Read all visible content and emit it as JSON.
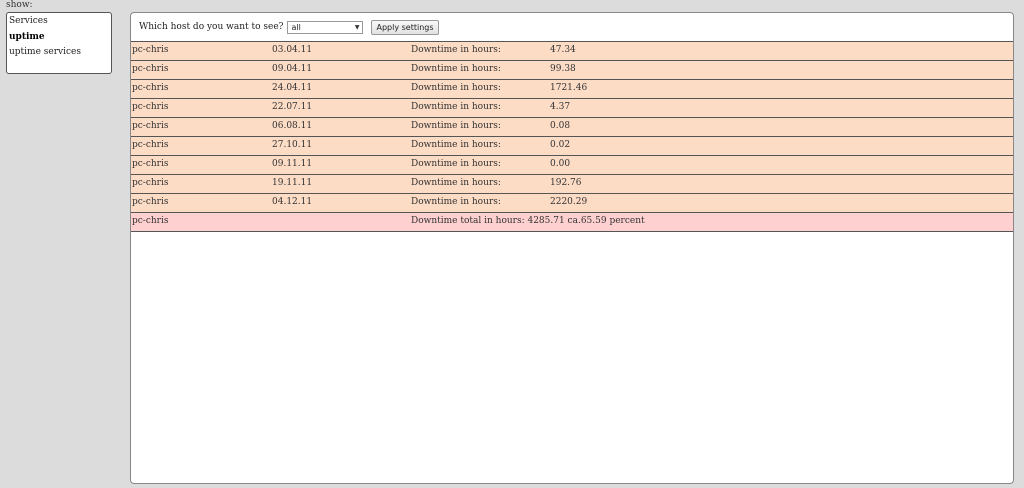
{
  "show_label": "show:",
  "nav": {
    "items": [
      {
        "label": "Services",
        "active": false
      },
      {
        "label": "uptime",
        "active": true
      },
      {
        "label": "uptime services",
        "active": false
      }
    ]
  },
  "toolbar": {
    "question": "Which host do you want to see?",
    "selected_host": "all",
    "apply_label": "Apply settings"
  },
  "rows": [
    {
      "host": "pc-chris",
      "date": "03.04.11",
      "label": "Downtime in hours:",
      "value": "47.34"
    },
    {
      "host": "pc-chris",
      "date": "09.04.11",
      "label": "Downtime in hours:",
      "value": "99.38"
    },
    {
      "host": "pc-chris",
      "date": "24.04.11",
      "label": "Downtime in hours:",
      "value": "1721.46"
    },
    {
      "host": "pc-chris",
      "date": "22.07.11",
      "label": "Downtime in hours:",
      "value": "4.37"
    },
    {
      "host": "pc-chris",
      "date": "06.08.11",
      "label": "Downtime in hours:",
      "value": "0.08"
    },
    {
      "host": "pc-chris",
      "date": "27.10.11",
      "label": "Downtime in hours:",
      "value": "0.02"
    },
    {
      "host": "pc-chris",
      "date": "09.11.11",
      "label": "Downtime in hours:",
      "value": "0.00"
    },
    {
      "host": "pc-chris",
      "date": "19.11.11",
      "label": "Downtime in hours:",
      "value": "192.76"
    },
    {
      "host": "pc-chris",
      "date": "04.12.11",
      "label": "Downtime in hours:",
      "value": "2220.29"
    }
  ],
  "total": {
    "host": "pc-chris",
    "text": "Downtime total in hours: 4285.71 ca.65.59 percent"
  },
  "colors": {
    "row_bg": "#fddcc6",
    "total_bg": "#ffd0d0"
  }
}
